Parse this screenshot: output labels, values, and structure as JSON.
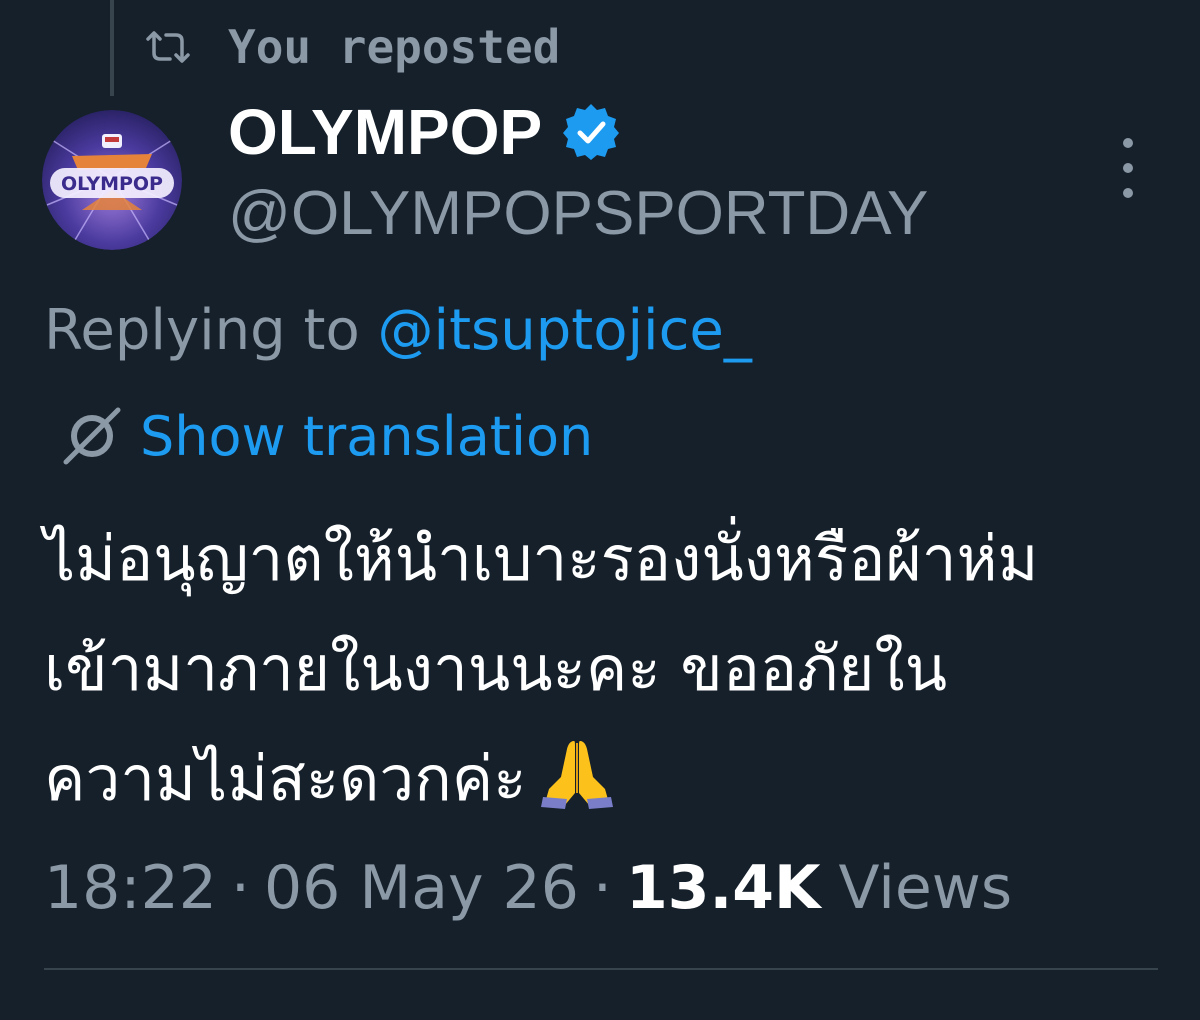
{
  "colors": {
    "background": "#15202b",
    "secondary_text": "#8b98a5",
    "accent_link": "#1d9bf0",
    "divider": "#38444d"
  },
  "repost": {
    "icon": "repost-icon",
    "label": "You reposted"
  },
  "author": {
    "avatar_logo_text": "OLYMPOP",
    "display_name": "OLYMPOP",
    "verified_icon": "verified-badge-icon",
    "handle": "@OLYMPOPSPORTDAY"
  },
  "more_icon": "more-vertical-icon",
  "reply": {
    "prefix": "Replying to",
    "mention": "@itsuptojice_"
  },
  "translation": {
    "icon": "translate-icon",
    "label": "Show translation"
  },
  "tweet": {
    "lines": [
      "ไม่อนุญาตให้นำเบาะรองนั่งหรือผ้าห่ม",
      "เข้ามาภายในงานนะคะ ขออภัยใน",
      "ความไม่สะดวกค่ะ"
    ],
    "emoji": "folded-hands-emoji"
  },
  "meta": {
    "time": "18:22",
    "separator": "·",
    "date": "06 May 26",
    "views_count": "13.4K",
    "views_label": "Views"
  }
}
